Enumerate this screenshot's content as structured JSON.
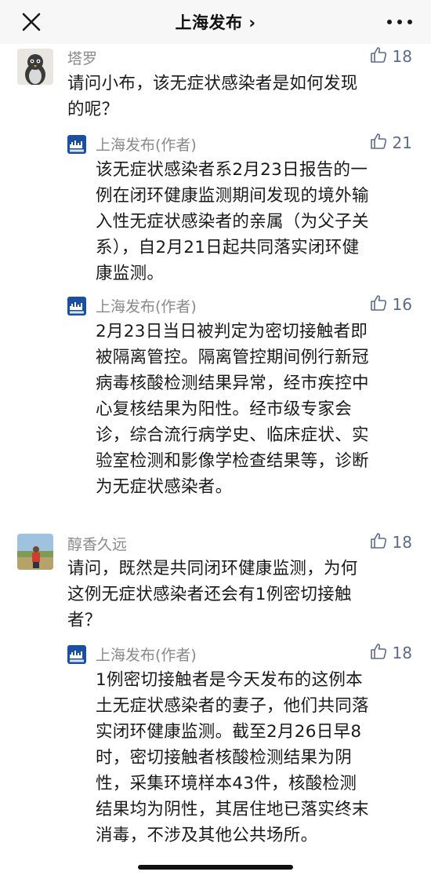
{
  "header": {
    "title": "上海发布 ›"
  },
  "comments": [
    {
      "user": "塔罗",
      "likes": "18",
      "lines": [
        "请问小布，该无症状感染者是如何发现",
        "的呢？"
      ]
    },
    {
      "user": "醇香久远",
      "likes": "18",
      "lines": [
        "请问，既然是共同闭环健康监测，为何",
        "这例无症状感染者还会有1例密切接触",
        "者？"
      ]
    }
  ],
  "replies": [
    {
      "author": "上海发布(作者)",
      "likes": "21",
      "lines": [
        "该无症状感染者系2月23日报告的一",
        "例在闭环健康监测期间发现的境外输",
        "入性无症状感染者的亲属（为父子关",
        "系），自2月21日起共同落实闭环健",
        "康监测。"
      ]
    },
    {
      "author": "上海发布(作者)",
      "likes": "16",
      "lines": [
        "2月23日当日被判定为密切接触者即",
        "被隔离管控。隔离管控期间例行新冠",
        "病毒核酸检测结果异常，经市疾控中",
        "心复核结果为阳性。经市级专家会",
        "诊，综合流行病学史、临床症状、实",
        "验室检测和影像学检查结果等，诊断",
        "为无症状感染者。"
      ]
    },
    {
      "author": "上海发布(作者)",
      "likes": "18",
      "lines": [
        "1例密切接触者是今天发布的这例本",
        "土无症状感染者的妻子，他们共同落",
        "实闭环健康监测。截至2月26日早8",
        "时，密切接触者核酸检测结果为阴",
        "性，采集环境样本43件，核酸检测",
        "结果均为阴性，其居住地已落实终末",
        "消毒，不涉及其他公共场所。"
      ]
    }
  ],
  "icons": {
    "like": "thumbs-up-icon",
    "close": "close-icon",
    "more": "more-dots-icon"
  },
  "colors": {
    "like_count": "#5b6b8c",
    "name": "#8a8a8a",
    "header_bg": "#f7f7f7"
  }
}
